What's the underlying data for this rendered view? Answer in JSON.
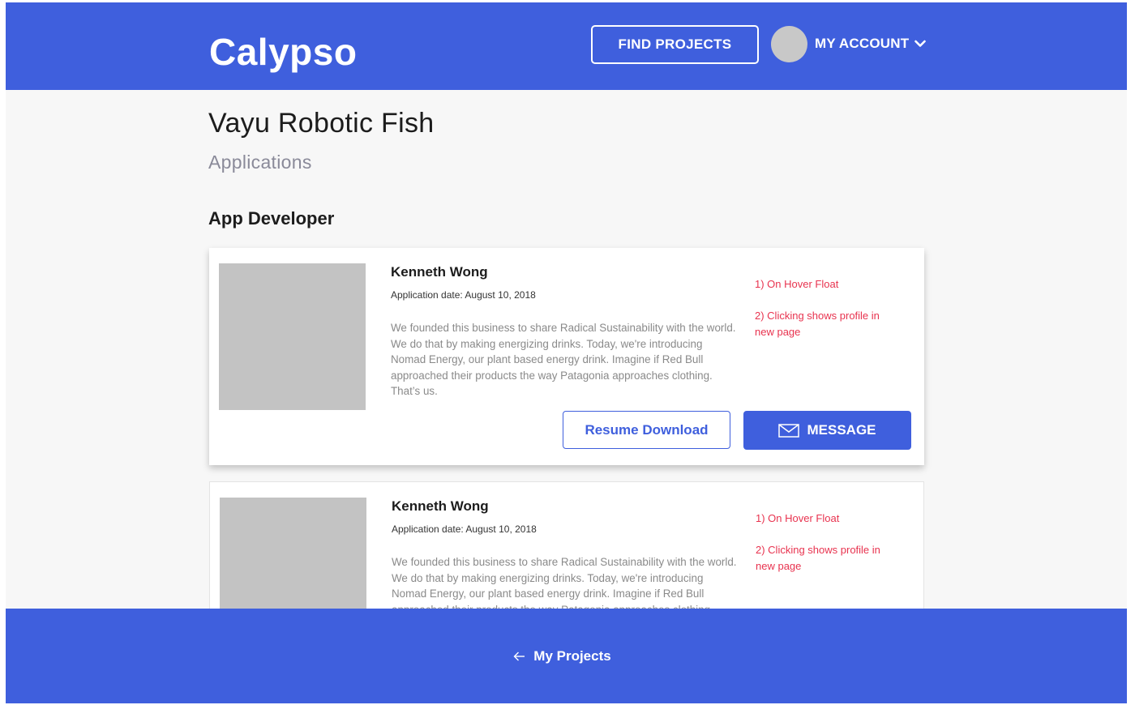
{
  "header": {
    "logo": "Calypso",
    "find_projects": "FIND PROJECTS",
    "account_label": "MY ACCOUNT"
  },
  "page": {
    "project_title": "Vayu Robotic Fish",
    "subtitle": "Applications",
    "role_heading": "App Developer"
  },
  "applications": [
    {
      "name": "Kenneth Wong",
      "date": "Application date: August 10, 2018",
      "description": "We founded this business to share Radical Sustainability with the world. We do that by making energizing drinks. Today, we're introducing Nomad Energy, our plant based energy drink.  Imagine if Red Bull approached their products the way Patagonia approaches clothing. That’s us.",
      "note_1": "1) On Hover Float",
      "note_2": "2) Clicking shows profile in new page",
      "resume_label": "Resume Download",
      "message_label": "MESSAGE"
    },
    {
      "name": "Kenneth Wong",
      "date": "Application date: August 10, 2018",
      "description": "We founded this business to share Radical Sustainability with the world. We do that by making energizing drinks. Today, we're introducing Nomad Energy, our plant based energy drink.  Imagine if Red Bull approached their products the way Patagonia approaches clothing. That’s us.",
      "note_1": "1) On Hover Float",
      "note_2": "2) Clicking shows profile in new page"
    }
  ],
  "footer": {
    "back_label": "My Projects"
  },
  "colors": {
    "brand": "#3f5fdd",
    "annotation": "#e8334f",
    "placeholder": "#c3c3c3"
  },
  "icons": {
    "account_dropdown": "chevron-down-icon",
    "message": "mail-icon",
    "back": "arrow-left-icon"
  }
}
